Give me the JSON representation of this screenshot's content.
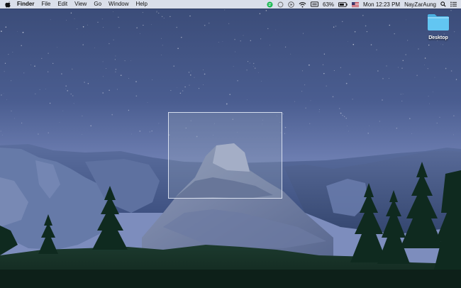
{
  "menubar": {
    "app_name": "Finder",
    "menus": [
      "File",
      "Edit",
      "View",
      "Go",
      "Window",
      "Help"
    ],
    "status": {
      "battery_percent": "63%",
      "clock": "Mon 12:23 PM",
      "user": "NayZarAung"
    },
    "icons": [
      "apple-icon",
      "chat-icon",
      "sync-icon",
      "play-icon",
      "wifi-icon",
      "keyboard-icon",
      "battery-icon",
      "flag-icon",
      "search-icon",
      "list-icon"
    ]
  },
  "desktop": {
    "folder_label": "Desktop"
  },
  "colors": {
    "sky_top": "#3b4d7a",
    "sky_bottom": "#6f80b3",
    "folder": "#5ec3f0"
  }
}
